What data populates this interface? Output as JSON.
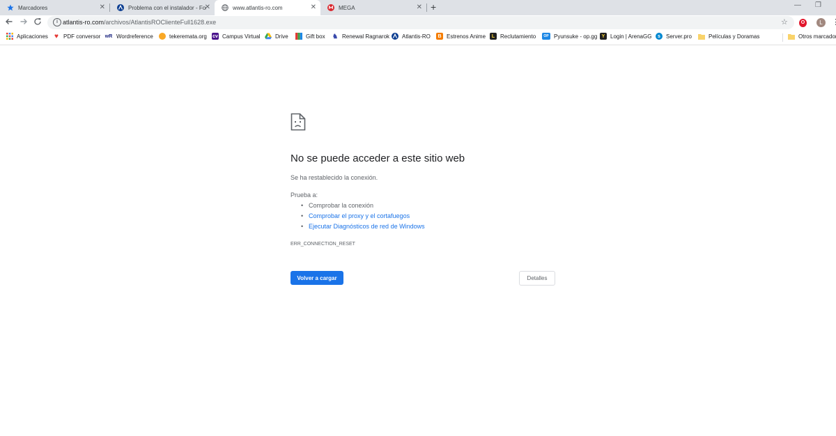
{
  "tabs": [
    {
      "title": "Marcadores",
      "icon": "star-icon",
      "close": "✕"
    },
    {
      "title": "Problema con el instalador - Foro",
      "icon": "atlantis-logo-icon",
      "close": "✕"
    },
    {
      "title": "www.atlantis-ro.com",
      "icon": "globe-icon",
      "close": "✕",
      "active": true
    },
    {
      "title": "MEGA",
      "icon": "mega-logo-icon",
      "close": "✕"
    }
  ],
  "new_tab_label": "+",
  "window_controls": {
    "minimize": "—",
    "restore": "❐"
  },
  "toolbar": {
    "url_host": "atlantis-ro.com",
    "url_path": "/archivos/AtlantisROClienteFull1628.exe",
    "avatar_letter": "L",
    "opera_letter": "O"
  },
  "bookmarks": [
    {
      "label": "Aplicaciones",
      "icon": "apps-grid-icon"
    },
    {
      "label": "PDF conversor",
      "icon": "heart-icon"
    },
    {
      "label": "Wordreference",
      "icon": "wordreference-icon"
    },
    {
      "label": "tekeremata.org",
      "icon": "sun-icon"
    },
    {
      "label": "Campus Virtual",
      "icon": "campus-icon"
    },
    {
      "label": "Drive",
      "icon": "drive-icon"
    },
    {
      "label": "Gift box",
      "icon": "gift-icon"
    },
    {
      "label": "Renewal Ragnarok",
      "icon": "ragnarok-icon"
    },
    {
      "label": "Atlantis-RO",
      "icon": "atlantis-logo-icon"
    },
    {
      "label": "Estrenos Anime",
      "icon": "blogger-icon"
    },
    {
      "label": "Reclutamiento",
      "icon": "recruit-icon"
    },
    {
      "label": "Pyunsuke - op.gg",
      "icon": "opgg-icon"
    },
    {
      "label": "Login | ArenaGG",
      "icon": "arenagg-icon"
    },
    {
      "label": "Server.pro",
      "icon": "serverpro-icon"
    },
    {
      "label": "Películas y Doramas",
      "icon": "folder-icon"
    },
    {
      "label": "Otros marcadores",
      "icon": "folder-icon"
    }
  ],
  "error": {
    "title": "No se puede acceder a este sitio web",
    "subtitle": "Se ha restablecido la conexión.",
    "try_label": "Prueba a:",
    "suggestions": [
      {
        "text": "Comprobar la conexión",
        "link": false
      },
      {
        "text": "Comprobar el proxy y el cortafuegos",
        "link": true
      },
      {
        "text": "Ejecutar Diagnósticos de red de Windows",
        "link": true
      }
    ],
    "code": "ERR_CONNECTION_RESET",
    "reload_label": "Volver a cargar",
    "details_label": "Detalles"
  },
  "colors": {
    "accent": "#1a73e8",
    "tabstrip": "#dee1e6",
    "text": "#202124",
    "secondary": "#5f6368"
  }
}
